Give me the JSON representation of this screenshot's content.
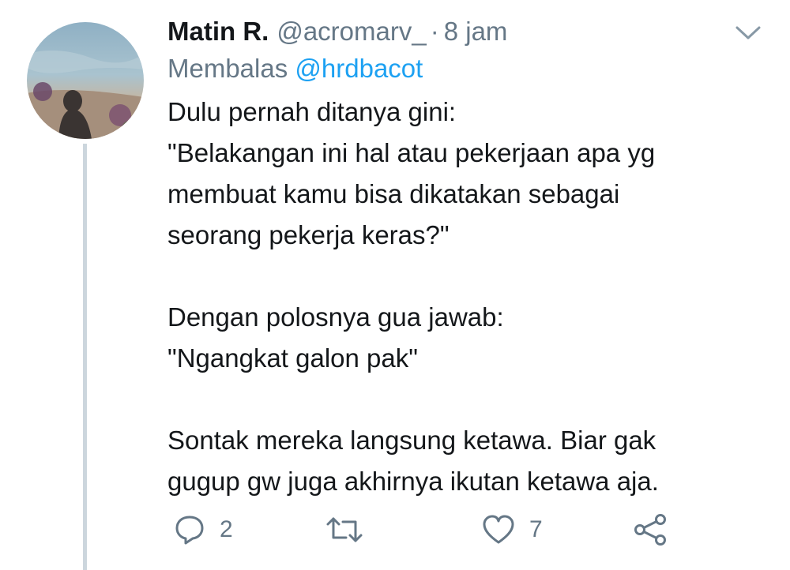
{
  "tweet": {
    "author_name": "Matin R.",
    "handle": "@acromarv_",
    "separator": "·",
    "time": "8 jam",
    "reply_prefix": "Membalas",
    "reply_to": "@hrdbacot",
    "lines_block1": [
      "Dulu pernah ditanya gini:",
      "\"Belakangan ini hal atau pekerjaan apa yg",
      "membuat kamu bisa dikatakan sebagai",
      "seorang pekerja keras?\""
    ],
    "lines_block2": [
      "Dengan polosnya gua jawab:",
      "\"Ngangkat galon pak\""
    ],
    "lines_block3": [
      "Sontak mereka langsung ketawa. Biar gak",
      "gugup gw juga akhirnya ikutan ketawa aja."
    ]
  },
  "actions": {
    "reply_count": "2",
    "like_count": "7"
  },
  "icons": {
    "menu": "chevron-down-icon",
    "reply": "reply-icon",
    "retweet": "retweet-icon",
    "like": "heart-icon",
    "share": "share-icon"
  },
  "colors": {
    "text": "#14171a",
    "muted": "#657786",
    "link": "#1da1f2",
    "thread_line": "#ccd6dd"
  }
}
